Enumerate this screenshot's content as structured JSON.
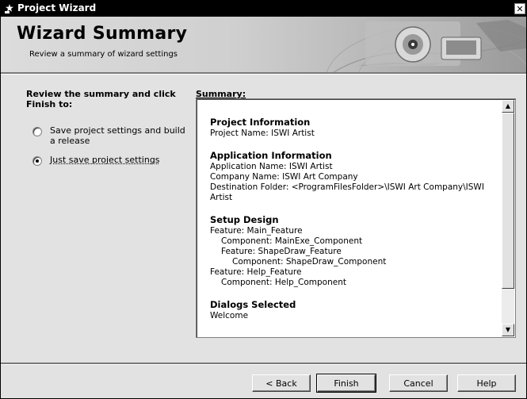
{
  "window": {
    "title": "Project Wizard",
    "close_glyph": "✕"
  },
  "header": {
    "title": "Wizard Summary",
    "subtitle": "Review a summary of wizard settings"
  },
  "instructions": "Review the summary and click Finish to:",
  "options": [
    {
      "label": "Save project settings and build a release",
      "checked": false
    },
    {
      "label": "Just save project settings",
      "checked": true
    }
  ],
  "summary": {
    "label": "Summary:",
    "sections": [
      {
        "title": "Project Information",
        "lines": [
          "Project Name: ISWI Artist"
        ]
      },
      {
        "title": "Application Information",
        "lines": [
          "Application Name: ISWI Artist",
          "Company Name: ISWI Art Company",
          "Destination Folder: <ProgramFilesFolder>\\ISWI Art Company\\ISWI Artist"
        ]
      },
      {
        "title": "Setup Design",
        "lines": [
          "Feature: Main_Feature",
          "Component: MainExe_Component",
          "Feature: ShapeDraw_Feature",
          "Component: ShapeDraw_Component",
          "Feature: Help_Feature",
          "Component: Help_Component"
        ]
      },
      {
        "title": "Dialogs Selected",
        "lines": [
          "Welcome"
        ]
      }
    ]
  },
  "scroll_icons": {
    "up": "▲",
    "down": "▼"
  },
  "buttons": {
    "back": "< Back",
    "finish": "Finish",
    "cancel": "Cancel",
    "help": "Help"
  }
}
